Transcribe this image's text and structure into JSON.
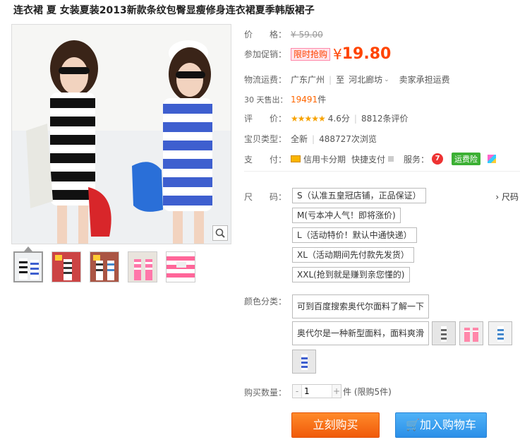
{
  "title": "连衣裙 夏 女装夏装2013新款条纹包臀显瘦修身连衣裙夏季韩版裙子",
  "price": {
    "label": "价　　格：",
    "original": "¥ 59.00"
  },
  "promo": {
    "label": "参加促销：",
    "badge": "限时抢购",
    "yen": "¥",
    "price": "19.80"
  },
  "shipping": {
    "label": "物流运费：",
    "from": "广东广州",
    "sep": "至",
    "to": "河北廊坊",
    "note": "卖家承担运费"
  },
  "sales": {
    "label": "30 天售出：",
    "count": "19491",
    "unit": "件"
  },
  "rating": {
    "label": "评　　价：",
    "stars": "★★★★★",
    "score": "4.6分",
    "count": "8812条评价"
  },
  "type": {
    "label": "宝贝类型：",
    "condition": "全新",
    "views": "488727次浏览"
  },
  "payment": {
    "label": "支　　付：",
    "installment": "信用卡分期",
    "quick": "快捷支付",
    "service_label": "服务：",
    "svc7": "7",
    "ship_badge": "运费险"
  },
  "size": {
    "label": "尺　　码：",
    "chart_link": "尺码",
    "options": [
      "S（认准五皇冠店铺，正品保证）",
      "M(亏本冲人气！即将涨价)",
      "L（活动特价！默认中通快递）",
      "XL（活动期间先付款先发货）",
      "XXL(抢到就是赚到亲您懂的)"
    ]
  },
  "color": {
    "label": "颜色分类：",
    "text_options": [
      "可到百度搜索奥代尔面料了解一下",
      "奥代尔是一种新型面料，面料爽滑"
    ]
  },
  "quantity": {
    "label": "购买数量：",
    "value": "1",
    "minus": "-",
    "plus": "+",
    "note": "件 (限购5件)"
  },
  "buttons": {
    "buy": "立刻购买",
    "cart": "加入购物车"
  },
  "colors": {
    "accent": "#ff4400",
    "buy_button": "#f26a10",
    "cart_button": "#3a9fee",
    "ship_badge": "#3cb034"
  }
}
